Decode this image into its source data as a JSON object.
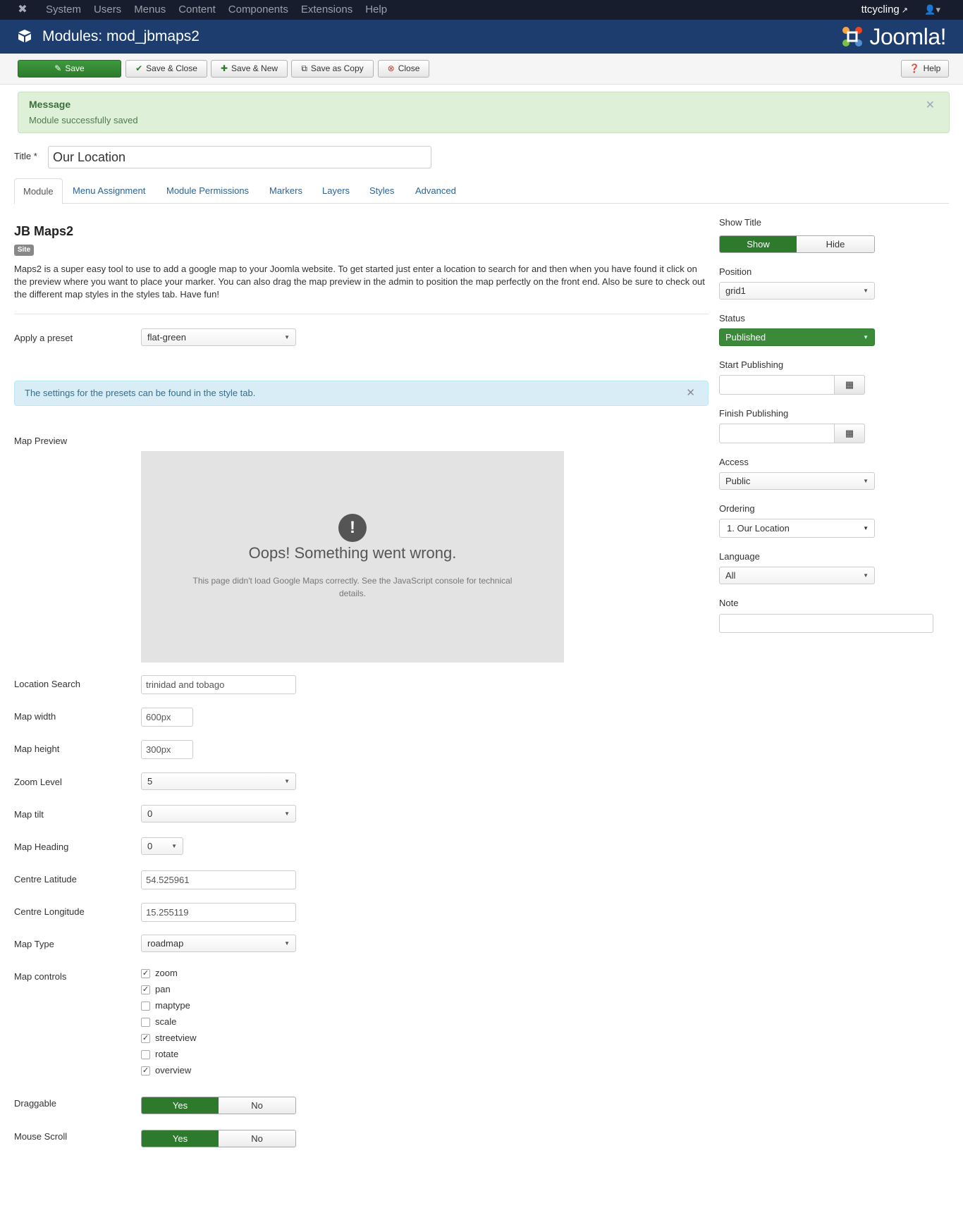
{
  "navbar": {
    "menu": [
      "System",
      "Users",
      "Menus",
      "Content",
      "Components",
      "Extensions",
      "Help"
    ],
    "user": "ttcycling"
  },
  "header": {
    "title": "Modules: mod_jbmaps2",
    "brand": "Joomla!"
  },
  "toolbar": {
    "save": "Save",
    "save_close": "Save & Close",
    "save_new": "Save & New",
    "save_copy": "Save as Copy",
    "close": "Close",
    "help": "Help"
  },
  "message": {
    "heading": "Message",
    "text": "Module successfully saved"
  },
  "title_field": {
    "label": "Title *",
    "value": "Our Location"
  },
  "tabs": [
    "Module",
    "Menu Assignment",
    "Module Permissions",
    "Markers",
    "Layers",
    "Styles",
    "Advanced"
  ],
  "module": {
    "heading": "JB Maps2",
    "badge": "Site",
    "description": "Maps2 is a super easy tool to use to add a google map to your Joomla website. To get started just enter a location to search for and then when you have found it click on the preview where you want to place your marker. You can also drag the map preview in the admin to position the map perfectly on the front end. Also be sure to check out the different map styles in the styles tab. Have fun!",
    "preset_label": "Apply a preset",
    "preset_value": "flat-green",
    "info_text": "The settings for the presets can be found in the style tab.",
    "map_preview_label": "Map Preview",
    "map_error_title": "Oops! Something went wrong.",
    "map_error_text": "This page didn't load Google Maps correctly. See the JavaScript console for technical details.",
    "location_search_label": "Location Search",
    "location_search_value": "trinidad and tobago",
    "map_width_label": "Map width",
    "map_width_value": "600px",
    "map_height_label": "Map height",
    "map_height_value": "300px",
    "zoom_label": "Zoom Level",
    "zoom_value": "5",
    "tilt_label": "Map tilt",
    "tilt_value": "0",
    "heading_label": "Map Heading",
    "heading_value": "0",
    "lat_label": "Centre Latitude",
    "lat_value": "54.525961",
    "lng_label": "Centre Longitude",
    "lng_value": "15.255119",
    "type_label": "Map Type",
    "type_value": "roadmap",
    "controls_label": "Map controls",
    "controls": [
      {
        "label": "zoom",
        "checked": true
      },
      {
        "label": "pan",
        "checked": true
      },
      {
        "label": "maptype",
        "checked": false
      },
      {
        "label": "scale",
        "checked": false
      },
      {
        "label": "streetview",
        "checked": true
      },
      {
        "label": "rotate",
        "checked": false
      },
      {
        "label": "overview",
        "checked": true
      }
    ],
    "draggable_label": "Draggable",
    "mouse_scroll_label": "Mouse Scroll",
    "yes": "Yes",
    "no": "No"
  },
  "sidebar": {
    "show_title_label": "Show Title",
    "show": "Show",
    "hide": "Hide",
    "position_label": "Position",
    "position_value": "grid1",
    "status_label": "Status",
    "status_value": "Published",
    "start_label": "Start Publishing",
    "finish_label": "Finish Publishing",
    "access_label": "Access",
    "access_value": "Public",
    "ordering_label": "Ordering",
    "ordering_value": "1. Our Location",
    "language_label": "Language",
    "language_value": "All",
    "note_label": "Note"
  },
  "colors": {
    "navbar": "#171d2d",
    "header": "#1c3d6e",
    "success": "#2d7a2d"
  }
}
